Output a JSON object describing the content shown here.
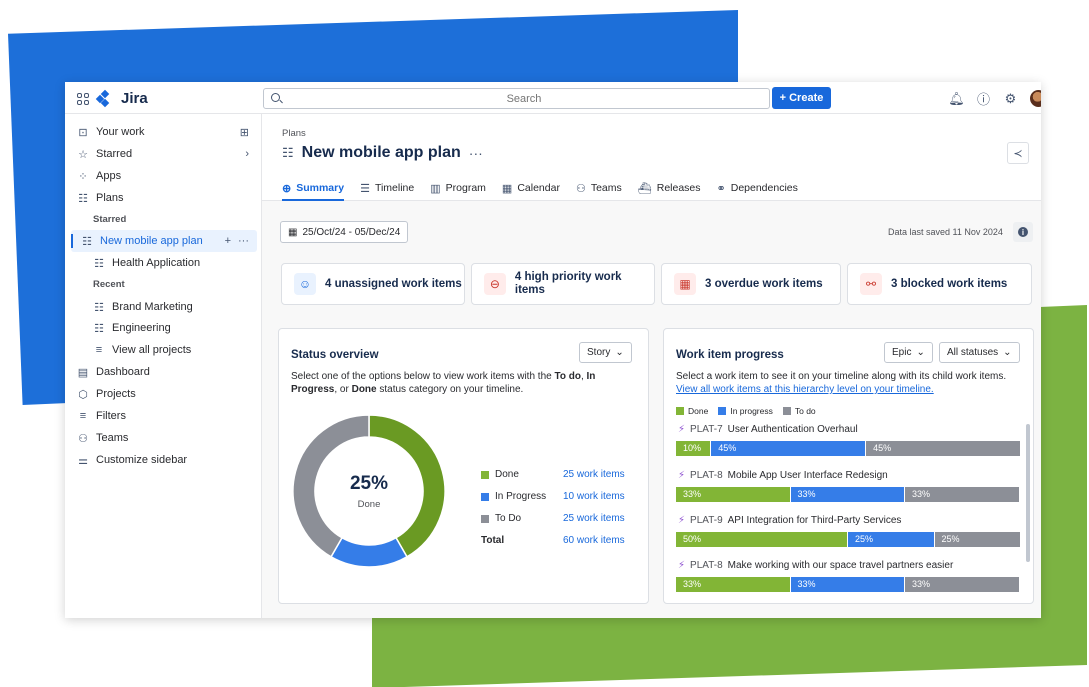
{
  "header": {
    "brand": "Jira",
    "search_placeholder": "Search",
    "create_label": "+ Create"
  },
  "sidebar": {
    "your_work": "Your work",
    "starred": "Starred",
    "apps": "Apps",
    "plans": "Plans",
    "plans_starred_heading": "Starred",
    "active_plan": "New mobile app plan",
    "health_app": "Health Application",
    "recent_heading": "Recent",
    "brand_marketing": "Brand Marketing",
    "engineering": "Engineering",
    "view_all_projects": "View all projects",
    "dashboard": "Dashboard",
    "projects": "Projects",
    "filters": "Filters",
    "teams": "Teams",
    "customize": "Customize sidebar"
  },
  "page": {
    "breadcrumb": "Plans",
    "title": "New mobile app plan",
    "title_more": "···",
    "tabs": [
      "Summary",
      "Timeline",
      "Program",
      "Calendar",
      "Teams",
      "Releases",
      "Dependencies"
    ],
    "date_range": "25/Oct/24 - 05/Dec/24",
    "last_saved": "Data last saved 11 Nov 2024"
  },
  "cards": [
    {
      "label": "4 unassigned work items",
      "color": "#1868db"
    },
    {
      "label": "4 high priority work items",
      "color": "#c9372c"
    },
    {
      "label": "3 overdue work items",
      "color": "#c9372c"
    },
    {
      "label": "3 blocked work items",
      "color": "#c9372c"
    }
  ],
  "status_overview": {
    "title": "Status overview",
    "filter": "Story",
    "desc_1": "Select one of the options below to view work items with the ",
    "desc_todo": "To do",
    "desc_comma": ", ",
    "desc_inprogress": "In Progress",
    "desc_or": ", or ",
    "desc_done": "Done",
    "desc_2": " status category on your timeline.",
    "center_value": "25%",
    "center_label": "Done",
    "legend": [
      {
        "label": "Done",
        "value": "25 work items"
      },
      {
        "label": "In Progress",
        "value": "10 work items"
      },
      {
        "label": "To Do",
        "value": "25 work items"
      }
    ],
    "total_label": "Total",
    "total_value": "60 work items"
  },
  "work_progress": {
    "title": "Work item progress",
    "filter_epic": "Epic",
    "filter_status": "All statuses",
    "desc": "Select a work item to see it on your timeline along with its child work items.",
    "link": "View all work items at this hierarchy level on your timeline.",
    "legend": [
      "Done",
      "In progress",
      "To do"
    ],
    "items": [
      {
        "key": "PLAT-7",
        "name": "User Authentication Overhaul",
        "done": 10,
        "in_progress": 45,
        "todo": 45
      },
      {
        "key": "PLAT-8",
        "name": "Mobile App User Interface Redesign",
        "done": 33,
        "in_progress": 33,
        "todo": 33
      },
      {
        "key": "PLAT-9",
        "name": "API Integration for Third-Party Services",
        "done": 50,
        "in_progress": 25,
        "todo": 25
      },
      {
        "key": "PLAT-8",
        "name": "Make working with our space travel partners easier",
        "done": 33,
        "in_progress": 33,
        "todo": 33
      }
    ]
  },
  "chart_data": {
    "type": "pie",
    "categories": [
      "Done",
      "In Progress",
      "To Do"
    ],
    "values": [
      25,
      10,
      25
    ],
    "colors": [
      "#6a9a23",
      "#357de8",
      "#8c8f97"
    ]
  },
  "colors": {
    "done": "#82b536",
    "in_progress": "#357de8",
    "todo": "#8c8f97",
    "accent": "#1868db"
  }
}
